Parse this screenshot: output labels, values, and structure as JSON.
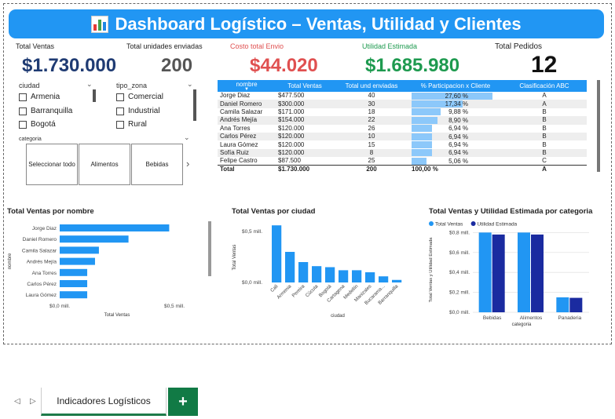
{
  "header": {
    "title": "Dashboard Logístico – Ventas, Utilidad y Clientes",
    "icon": "bar-chart-icon"
  },
  "kpis": {
    "total_ventas": {
      "label": "Total Ventas",
      "value": "$1.730.000",
      "color": "#1f3b73"
    },
    "total_unidades": {
      "label": "Total unidades enviadas",
      "value": "200",
      "color": "#555555"
    },
    "costo_envio": {
      "label": "Costo total Envio",
      "value": "$44.020",
      "color": "#e05050"
    },
    "utilidad": {
      "label": "Utilidad Estimada",
      "value": "$1.685.980",
      "color": "#1e9a4f"
    },
    "pedidos": {
      "label": "Total Pedidos",
      "value": "12",
      "color": "#111111"
    }
  },
  "slicers": {
    "ciudad": {
      "label": "ciudad",
      "options": [
        "Armenia",
        "Barranquilla",
        "Bogotá"
      ]
    },
    "zona": {
      "label": "tipo_zona",
      "options": [
        "Comercial",
        "Industrial",
        "Rural"
      ]
    },
    "categoria": {
      "label": "categoria",
      "tiles": [
        "Seleccionar todo",
        "Alimentos",
        "Bebidas"
      ],
      "next_icon": "chevron-right-icon"
    }
  },
  "table": {
    "columns": [
      "nombre",
      "Total Ventas",
      "Total und enviadas",
      "% Participacion x Cliente",
      "Clasificación ABC"
    ],
    "rows": [
      {
        "nombre": "Jorge Diaz",
        "ventas": "$477.500",
        "und": "40",
        "pct": "27,60 %",
        "pct_value": 27.6,
        "abc": "A"
      },
      {
        "nombre": "Daniel Romero",
        "ventas": "$300.000",
        "und": "30",
        "pct": "17,34 %",
        "pct_value": 17.34,
        "abc": "A"
      },
      {
        "nombre": "Camila Salazar",
        "ventas": "$171.000",
        "und": "18",
        "pct": "9,88 %",
        "pct_value": 9.88,
        "abc": "B"
      },
      {
        "nombre": "Andrés Mejía",
        "ventas": "$154.000",
        "und": "22",
        "pct": "8,90 %",
        "pct_value": 8.9,
        "abc": "B"
      },
      {
        "nombre": "Ana Torres",
        "ventas": "$120.000",
        "und": "26",
        "pct": "6,94 %",
        "pct_value": 6.94,
        "abc": "B"
      },
      {
        "nombre": "Carlos Pérez",
        "ventas": "$120.000",
        "und": "10",
        "pct": "6,94 %",
        "pct_value": 6.94,
        "abc": "B"
      },
      {
        "nombre": "Laura Gómez",
        "ventas": "$120.000",
        "und": "15",
        "pct": "6,94 %",
        "pct_value": 6.94,
        "abc": "B"
      },
      {
        "nombre": "Sofía Ruiz",
        "ventas": "$120.000",
        "und": "8",
        "pct": "6,94 %",
        "pct_value": 6.94,
        "abc": "B"
      },
      {
        "nombre": "Felipe Castro",
        "ventas": "$87.500",
        "und": "25",
        "pct": "5,06 %",
        "pct_value": 5.06,
        "abc": "C"
      }
    ],
    "total": {
      "nombre": "Total",
      "ventas": "$1.730.000",
      "und": "200",
      "pct": "100,00 %",
      "abc": "A"
    }
  },
  "chart_data": [
    {
      "type": "bar",
      "orientation": "horizontal",
      "title": "Total Ventas por nombre",
      "xlabel": "Total Ventas",
      "ylabel": "nombre",
      "categories": [
        "Jorge Diaz",
        "Daniel Romero",
        "Camila Salazar",
        "Andrés Mejía",
        "Ana Torres",
        "Carlos Pérez",
        "Laura Gómez"
      ],
      "values": [
        477500,
        300000,
        171000,
        154000,
        120000,
        120000,
        120000
      ],
      "xlim": [
        0,
        500000
      ],
      "tick_labels": [
        "$0,0 mill.",
        "$0,5 mill."
      ],
      "color": "#2196f3"
    },
    {
      "type": "bar",
      "title": "Total Ventas por ciudad",
      "xlabel": "ciudad",
      "ylabel": "Total Ventas",
      "categories": [
        "Cali",
        "Armenia",
        "Pereira",
        "Cúcuta",
        "Bogotá",
        "Cartagena",
        "Medellín",
        "Manizales",
        "Bucarama...",
        "Barranquilla"
      ],
      "values": [
        560000,
        300000,
        200000,
        160000,
        150000,
        120000,
        120000,
        100000,
        60000,
        25000
      ],
      "ylim": [
        0,
        600000
      ],
      "tick_labels": [
        "$0,0 mill.",
        "$0,5 mill."
      ],
      "color": "#2196f3"
    },
    {
      "type": "bar",
      "title": "Total Ventas y Utilidad Estimada por categoria",
      "xlabel": "categoria",
      "ylabel": "Total Ventas y Utilidad Estimada",
      "categories": [
        "Bebidas",
        "Alimentos",
        "Panaderia"
      ],
      "series": [
        {
          "name": "Total Ventas",
          "values": [
            800000,
            800000,
            150000
          ],
          "color": "#2196f3"
        },
        {
          "name": "Utilidad Estimada",
          "values": [
            780000,
            780000,
            145000
          ],
          "color": "#1a2ba0"
        }
      ],
      "ylim": [
        0,
        850000
      ],
      "tick_labels": [
        "$0,0 mill.",
        "$0,2 mill.",
        "$0,4 mill.",
        "$0,6 mill.",
        "$0,8 mill."
      ],
      "legend": "top-left"
    }
  ],
  "tabs": {
    "active": "Indicadores Logísticos",
    "add_label": "+",
    "prev_icon": "triangle-left-icon",
    "next_icon": "triangle-right-icon"
  }
}
